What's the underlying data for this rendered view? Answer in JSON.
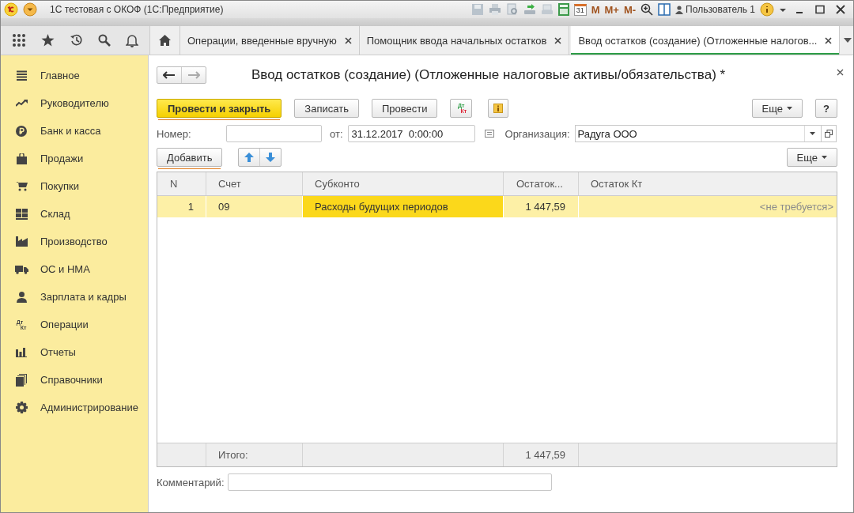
{
  "window": {
    "title": "1С тестовая с ОКОФ  (1С:Предприятие)",
    "memory_buttons": [
      "M",
      "M+",
      "M-"
    ],
    "calendar_day": "31",
    "user": "Пользователь 1"
  },
  "tabs": [
    {
      "label": "Операции, введенные вручную",
      "selected": false
    },
    {
      "label": "Помощник ввода начальных остатков",
      "selected": false
    },
    {
      "label": "Ввод остатков (создание) (Отложенные налогов...",
      "selected": true
    }
  ],
  "sidebar": {
    "items": [
      {
        "label": "Главное",
        "kind": "list"
      },
      {
        "label": "Руководителю",
        "kind": "trend"
      },
      {
        "label": "Банк и касса",
        "kind": "ruble"
      },
      {
        "label": "Продажи",
        "kind": "bag"
      },
      {
        "label": "Покупки",
        "kind": "cart"
      },
      {
        "label": "Склад",
        "kind": "grid"
      },
      {
        "label": "Производство",
        "kind": "factory"
      },
      {
        "label": "ОС и НМА",
        "kind": "truck"
      },
      {
        "label": "Зарплата и кадры",
        "kind": "person"
      },
      {
        "label": "Операции",
        "kind": "dtkt",
        "icon_text": [
          "Дт",
          "Кт"
        ]
      },
      {
        "label": "Отчеты",
        "kind": "bars"
      },
      {
        "label": "Справочники",
        "kind": "books"
      },
      {
        "label": "Администрирование",
        "kind": "gear"
      }
    ]
  },
  "form": {
    "title": "Ввод остатков (создание) (Отложенные налоговые активы/обязательства) *",
    "buttons": {
      "post_and_close": "Провести и закрыть",
      "write": "Записать",
      "post": "Провести",
      "dtkt": [
        "Дт",
        "Кт"
      ],
      "more": "Еще",
      "help": "?"
    },
    "number": {
      "label": "Номер:"
    },
    "date": {
      "label": "от:",
      "value": "31.12.2017  0:00:00"
    },
    "organization": {
      "label": "Организация:",
      "value": "Радуга ООО"
    },
    "table_toolbar": {
      "add": "Добавить",
      "more": "Еще"
    },
    "table": {
      "columns": [
        "N",
        "Счет",
        "Субконто",
        "Остаток...",
        "Остаток Кт"
      ],
      "rows": [
        {
          "n": "1",
          "account": "09",
          "subconto": "Расходы будущих периодов",
          "debit": "1 447,59",
          "credit_placeholder": "<не требуется>",
          "selected": true
        }
      ],
      "footer": {
        "label": "Итого:",
        "total": "1 447,59"
      }
    },
    "comment": {
      "label": "Комментарий:"
    }
  }
}
